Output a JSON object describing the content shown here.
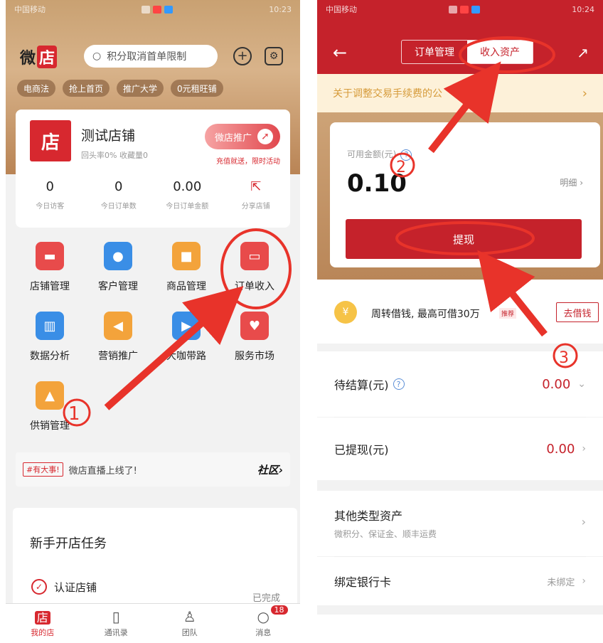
{
  "status_bar": {
    "carrier": "中国移动",
    "time": "10:23"
  },
  "left": {
    "logo": {
      "prefix": "微",
      "mark": "店"
    },
    "search": {
      "placeholder": "积分取消首单限制"
    },
    "chips": [
      "电商法",
      "抢上首页",
      "推广大学",
      "0元租旺铺"
    ],
    "shop": {
      "icon": "店",
      "name": "测试店铺",
      "sub": "回头率0% 收藏量0",
      "promo": "微店推广",
      "promo_sub": "充值就送，限时活动"
    },
    "stats": [
      {
        "v": "0",
        "k": "今日访客"
      },
      {
        "v": "0",
        "k": "今日订单数"
      },
      {
        "v": "0.00",
        "k": "今日订单金额"
      },
      {
        "v": "",
        "k": "分享店铺"
      }
    ],
    "grid": [
      {
        "label": "店铺管理",
        "color": "#e84b4b"
      },
      {
        "label": "客户管理",
        "color": "#3a8ee6"
      },
      {
        "label": "商品管理",
        "color": "#f3a33b"
      },
      {
        "label": "订单收入",
        "color": "#e84b4b"
      },
      {
        "label": "数据分析",
        "color": "#3a8ee6"
      },
      {
        "label": "营销推广",
        "color": "#f3a33b"
      },
      {
        "label": "大咖带路",
        "color": "#3a8ee6"
      },
      {
        "label": "服务市场",
        "color": "#e84b4b"
      },
      {
        "label": "供销管理",
        "color": "#f3a33b"
      }
    ],
    "notice": {
      "tag": "#有大事!",
      "text": "微店直播上线了!",
      "link": "社区›"
    },
    "task": {
      "title": "新手开店任务",
      "item": "认证店铺",
      "status": "已完成"
    },
    "tabs": [
      {
        "label": "我的店",
        "icon": "店"
      },
      {
        "label": "通讯录"
      },
      {
        "label": "团队"
      },
      {
        "label": "消息",
        "badge": "18"
      }
    ]
  },
  "right": {
    "status_time": "10:24",
    "segments": [
      "订单管理",
      "收入资产"
    ],
    "announcement": "关于调整交易手续费的公",
    "balance": {
      "label": "可用金额(元)",
      "value": "0.10",
      "detail": "明细 ›",
      "button": "提现"
    },
    "loan": {
      "coin": "¥",
      "text": "周转借钱, 最高可借30万",
      "tag": "推荐",
      "button": "去借钱"
    },
    "rows": [
      {
        "label": "待结算(元)",
        "value": "0.00"
      },
      {
        "label": "已提现(元)",
        "value": "0.00"
      }
    ],
    "other": {
      "label": "其他类型资产",
      "sub": "微积分、保证金、顺丰运费"
    },
    "bank": {
      "label": "绑定银行卡",
      "status": "未绑定"
    }
  },
  "annotations": {
    "steps": [
      "1",
      "2",
      "3"
    ],
    "color": "#e8332a"
  }
}
